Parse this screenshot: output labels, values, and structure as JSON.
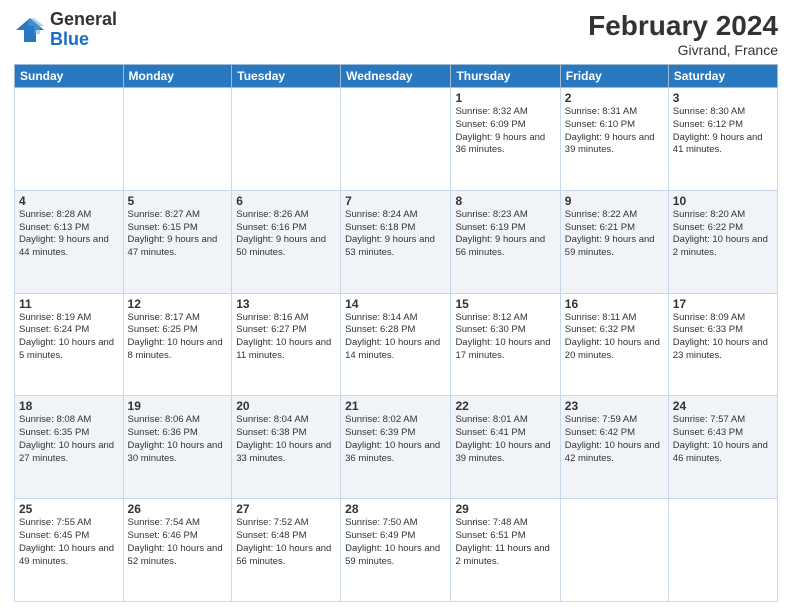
{
  "header": {
    "logo_general": "General",
    "logo_blue": "Blue",
    "month_title": "February 2024",
    "location": "Givrand, France"
  },
  "days_of_week": [
    "Sunday",
    "Monday",
    "Tuesday",
    "Wednesday",
    "Thursday",
    "Friday",
    "Saturday"
  ],
  "weeks": [
    [
      {
        "day": "",
        "info": ""
      },
      {
        "day": "",
        "info": ""
      },
      {
        "day": "",
        "info": ""
      },
      {
        "day": "",
        "info": ""
      },
      {
        "day": "1",
        "info": "Sunrise: 8:32 AM\nSunset: 6:09 PM\nDaylight: 9 hours and 36 minutes."
      },
      {
        "day": "2",
        "info": "Sunrise: 8:31 AM\nSunset: 6:10 PM\nDaylight: 9 hours and 39 minutes."
      },
      {
        "day": "3",
        "info": "Sunrise: 8:30 AM\nSunset: 6:12 PM\nDaylight: 9 hours and 41 minutes."
      }
    ],
    [
      {
        "day": "4",
        "info": "Sunrise: 8:28 AM\nSunset: 6:13 PM\nDaylight: 9 hours and 44 minutes."
      },
      {
        "day": "5",
        "info": "Sunrise: 8:27 AM\nSunset: 6:15 PM\nDaylight: 9 hours and 47 minutes."
      },
      {
        "day": "6",
        "info": "Sunrise: 8:26 AM\nSunset: 6:16 PM\nDaylight: 9 hours and 50 minutes."
      },
      {
        "day": "7",
        "info": "Sunrise: 8:24 AM\nSunset: 6:18 PM\nDaylight: 9 hours and 53 minutes."
      },
      {
        "day": "8",
        "info": "Sunrise: 8:23 AM\nSunset: 6:19 PM\nDaylight: 9 hours and 56 minutes."
      },
      {
        "day": "9",
        "info": "Sunrise: 8:22 AM\nSunset: 6:21 PM\nDaylight: 9 hours and 59 minutes."
      },
      {
        "day": "10",
        "info": "Sunrise: 8:20 AM\nSunset: 6:22 PM\nDaylight: 10 hours and 2 minutes."
      }
    ],
    [
      {
        "day": "11",
        "info": "Sunrise: 8:19 AM\nSunset: 6:24 PM\nDaylight: 10 hours and 5 minutes."
      },
      {
        "day": "12",
        "info": "Sunrise: 8:17 AM\nSunset: 6:25 PM\nDaylight: 10 hours and 8 minutes."
      },
      {
        "day": "13",
        "info": "Sunrise: 8:16 AM\nSunset: 6:27 PM\nDaylight: 10 hours and 11 minutes."
      },
      {
        "day": "14",
        "info": "Sunrise: 8:14 AM\nSunset: 6:28 PM\nDaylight: 10 hours and 14 minutes."
      },
      {
        "day": "15",
        "info": "Sunrise: 8:12 AM\nSunset: 6:30 PM\nDaylight: 10 hours and 17 minutes."
      },
      {
        "day": "16",
        "info": "Sunrise: 8:11 AM\nSunset: 6:32 PM\nDaylight: 10 hours and 20 minutes."
      },
      {
        "day": "17",
        "info": "Sunrise: 8:09 AM\nSunset: 6:33 PM\nDaylight: 10 hours and 23 minutes."
      }
    ],
    [
      {
        "day": "18",
        "info": "Sunrise: 8:08 AM\nSunset: 6:35 PM\nDaylight: 10 hours and 27 minutes."
      },
      {
        "day": "19",
        "info": "Sunrise: 8:06 AM\nSunset: 6:36 PM\nDaylight: 10 hours and 30 minutes."
      },
      {
        "day": "20",
        "info": "Sunrise: 8:04 AM\nSunset: 6:38 PM\nDaylight: 10 hours and 33 minutes."
      },
      {
        "day": "21",
        "info": "Sunrise: 8:02 AM\nSunset: 6:39 PM\nDaylight: 10 hours and 36 minutes."
      },
      {
        "day": "22",
        "info": "Sunrise: 8:01 AM\nSunset: 6:41 PM\nDaylight: 10 hours and 39 minutes."
      },
      {
        "day": "23",
        "info": "Sunrise: 7:59 AM\nSunset: 6:42 PM\nDaylight: 10 hours and 42 minutes."
      },
      {
        "day": "24",
        "info": "Sunrise: 7:57 AM\nSunset: 6:43 PM\nDaylight: 10 hours and 46 minutes."
      }
    ],
    [
      {
        "day": "25",
        "info": "Sunrise: 7:55 AM\nSunset: 6:45 PM\nDaylight: 10 hours and 49 minutes."
      },
      {
        "day": "26",
        "info": "Sunrise: 7:54 AM\nSunset: 6:46 PM\nDaylight: 10 hours and 52 minutes."
      },
      {
        "day": "27",
        "info": "Sunrise: 7:52 AM\nSunset: 6:48 PM\nDaylight: 10 hours and 56 minutes."
      },
      {
        "day": "28",
        "info": "Sunrise: 7:50 AM\nSunset: 6:49 PM\nDaylight: 10 hours and 59 minutes."
      },
      {
        "day": "29",
        "info": "Sunrise: 7:48 AM\nSunset: 6:51 PM\nDaylight: 11 hours and 2 minutes."
      },
      {
        "day": "",
        "info": ""
      },
      {
        "day": "",
        "info": ""
      }
    ]
  ]
}
